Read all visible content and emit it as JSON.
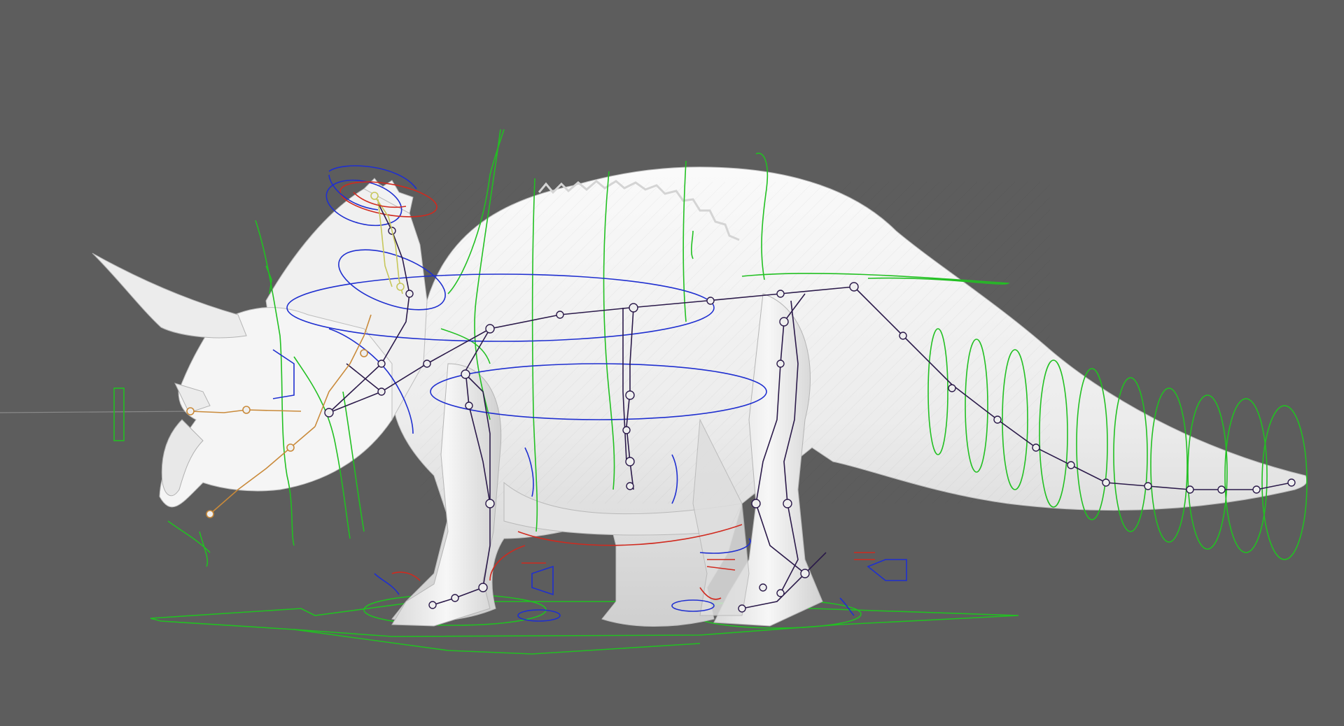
{
  "viewport": {
    "background": "#5d5d5d",
    "view": "side"
  },
  "scene": {
    "subject": "triceratops-mesh",
    "mesh_color": "#f2f2f2",
    "joint_color": "#2b1a4a",
    "fk_color": "#22c022",
    "ik_blue_color": "#1f2fd0",
    "ik_red_color": "#d02a1f",
    "jaw_chain_color": "#c98a3a",
    "crest_chain_color": "#c7c75a"
  }
}
